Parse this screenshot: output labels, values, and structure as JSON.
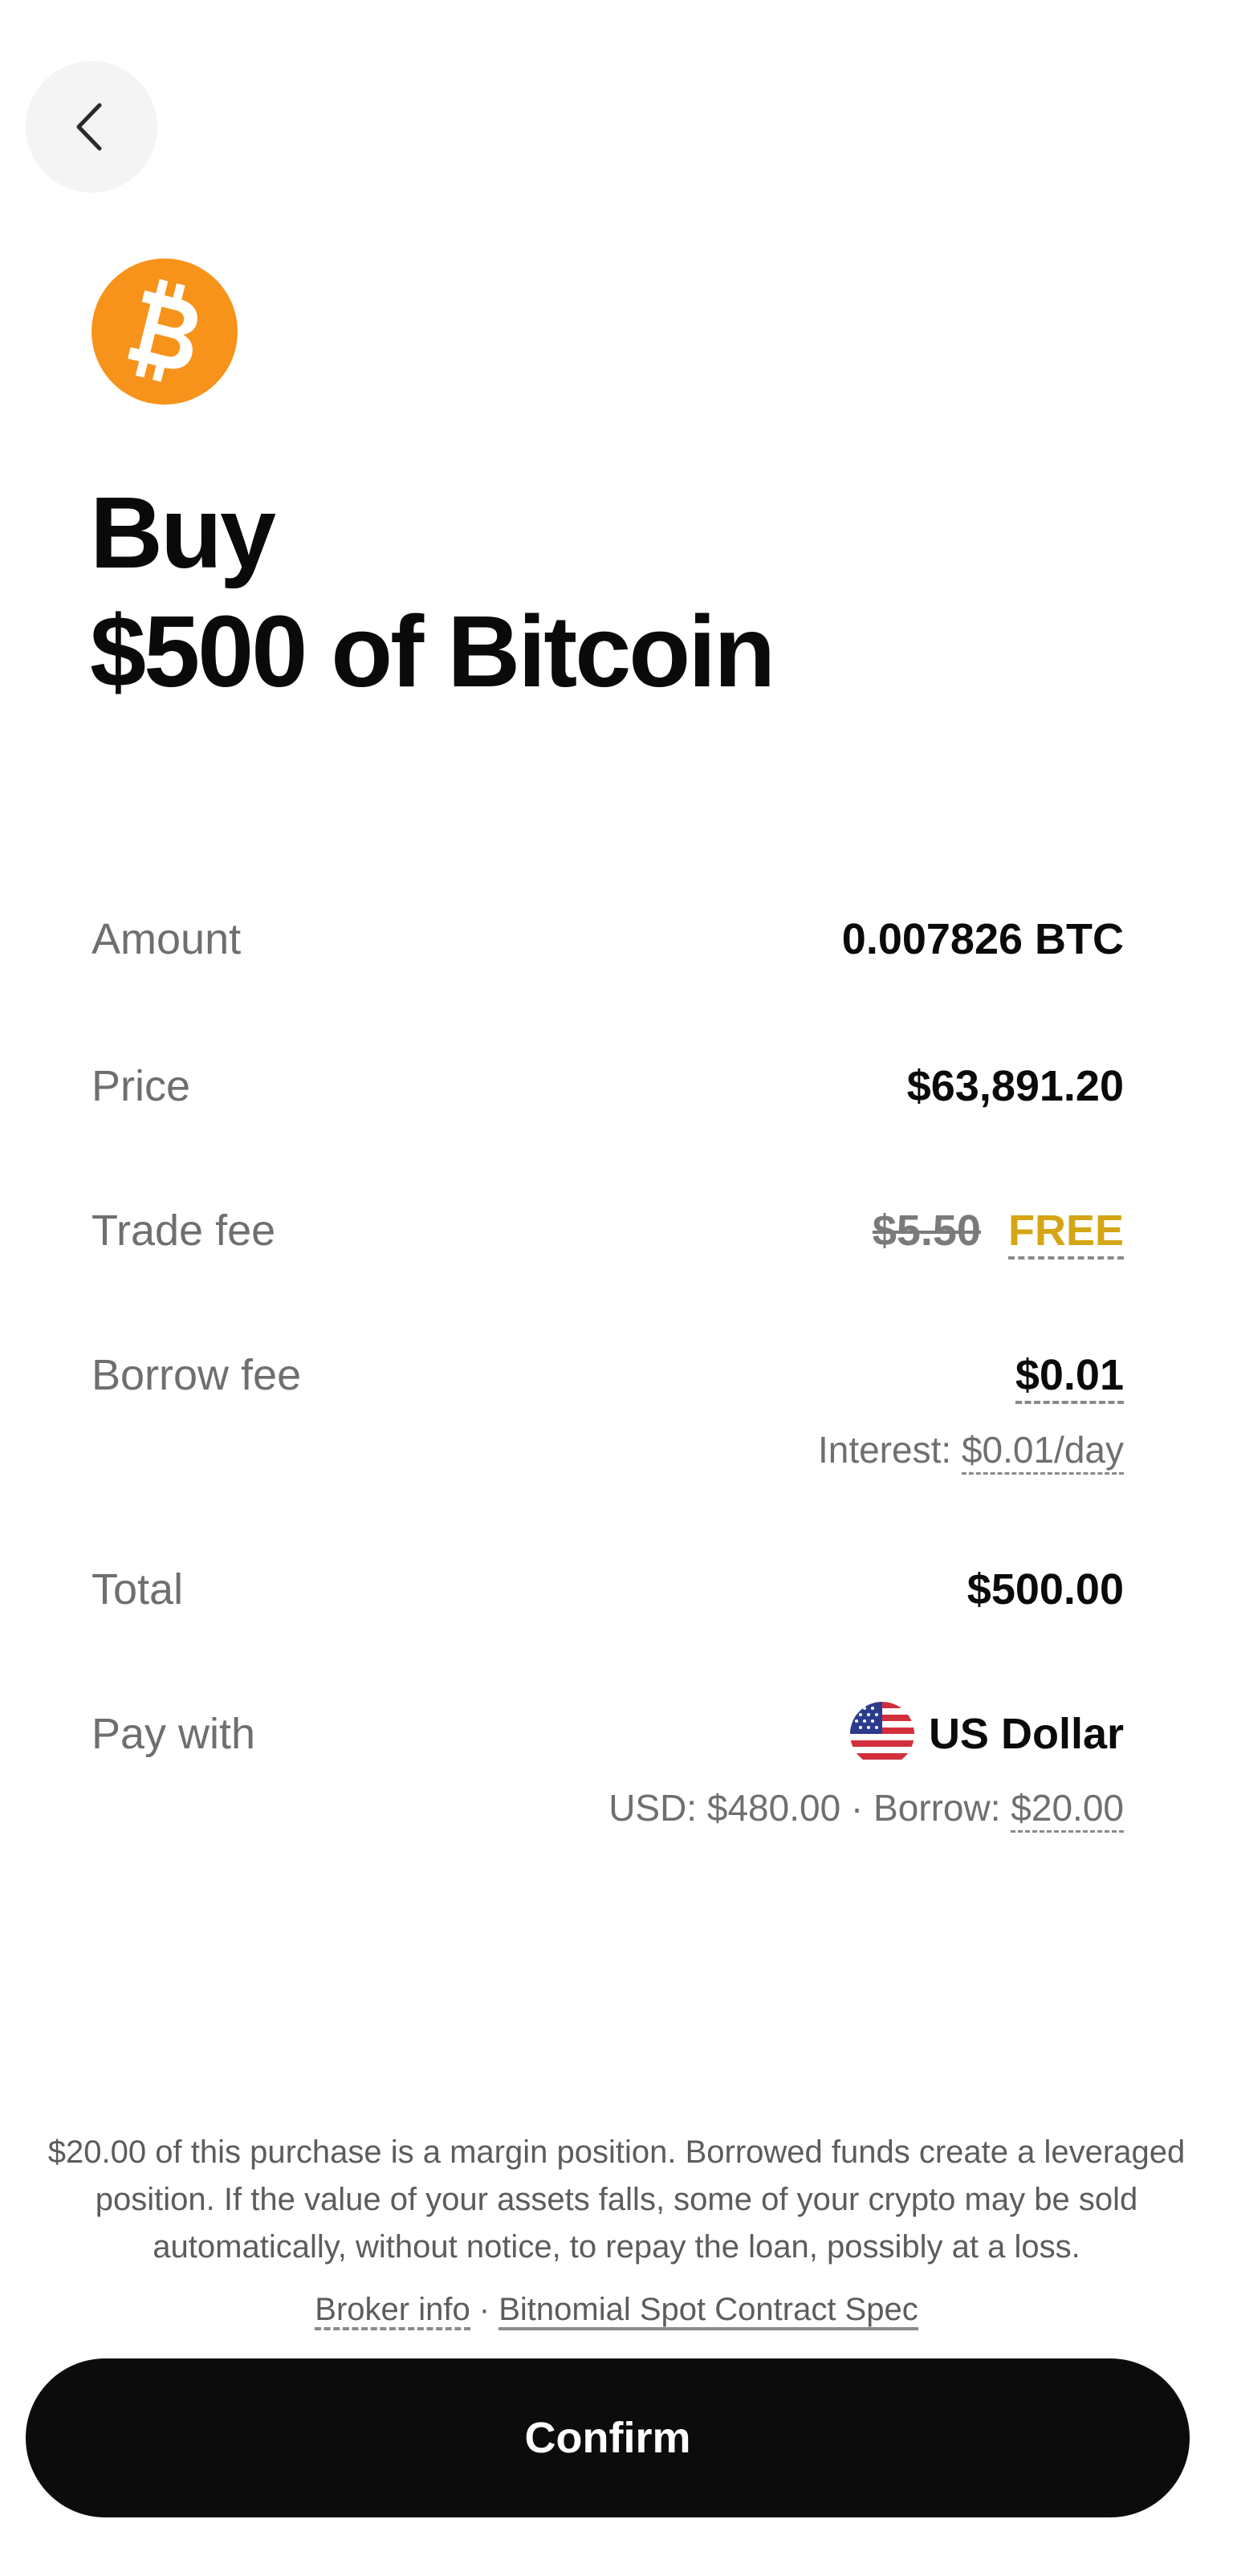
{
  "header": {
    "back_icon": "chevron-left-icon",
    "coin_icon": "bitcoin-icon",
    "coin_color": "#F7931A"
  },
  "title": {
    "line1": "Buy",
    "line2": "$500 of Bitcoin"
  },
  "details": {
    "amount": {
      "label": "Amount",
      "value": "0.007826 BTC"
    },
    "price": {
      "label": "Price",
      "value": "$63,891.20"
    },
    "trade_fee": {
      "label": "Trade fee",
      "original": "$5.50",
      "value": "FREE"
    },
    "borrow_fee": {
      "label": "Borrow fee",
      "value": "$0.01",
      "interest_prefix": "Interest:",
      "interest_value": "$0.01/day"
    },
    "total": {
      "label": "Total",
      "value": "$500.00"
    },
    "pay_with": {
      "label": "Pay with",
      "currency": "US Dollar",
      "flag_icon": "us-flag-icon",
      "breakdown_prefix": "USD: $480.00 · Borrow:",
      "borrow_value": "$20.00"
    }
  },
  "footer": {
    "disclaimer": "$20.00 of this purchase is a margin position. Borrowed funds create a leveraged position. If the value of your assets falls, some of your crypto may be sold automatically, without notice, to repay the loan, possibly at a loss.",
    "broker_link": "Broker info",
    "separator": " · ",
    "spec_link": "Bitnomial Spot Contract Spec",
    "confirm_label": "Confirm"
  },
  "colors": {
    "free": "#D4A514",
    "confirm_bg": "#0C0C0C",
    "back_bg": "#F4F4F4"
  }
}
